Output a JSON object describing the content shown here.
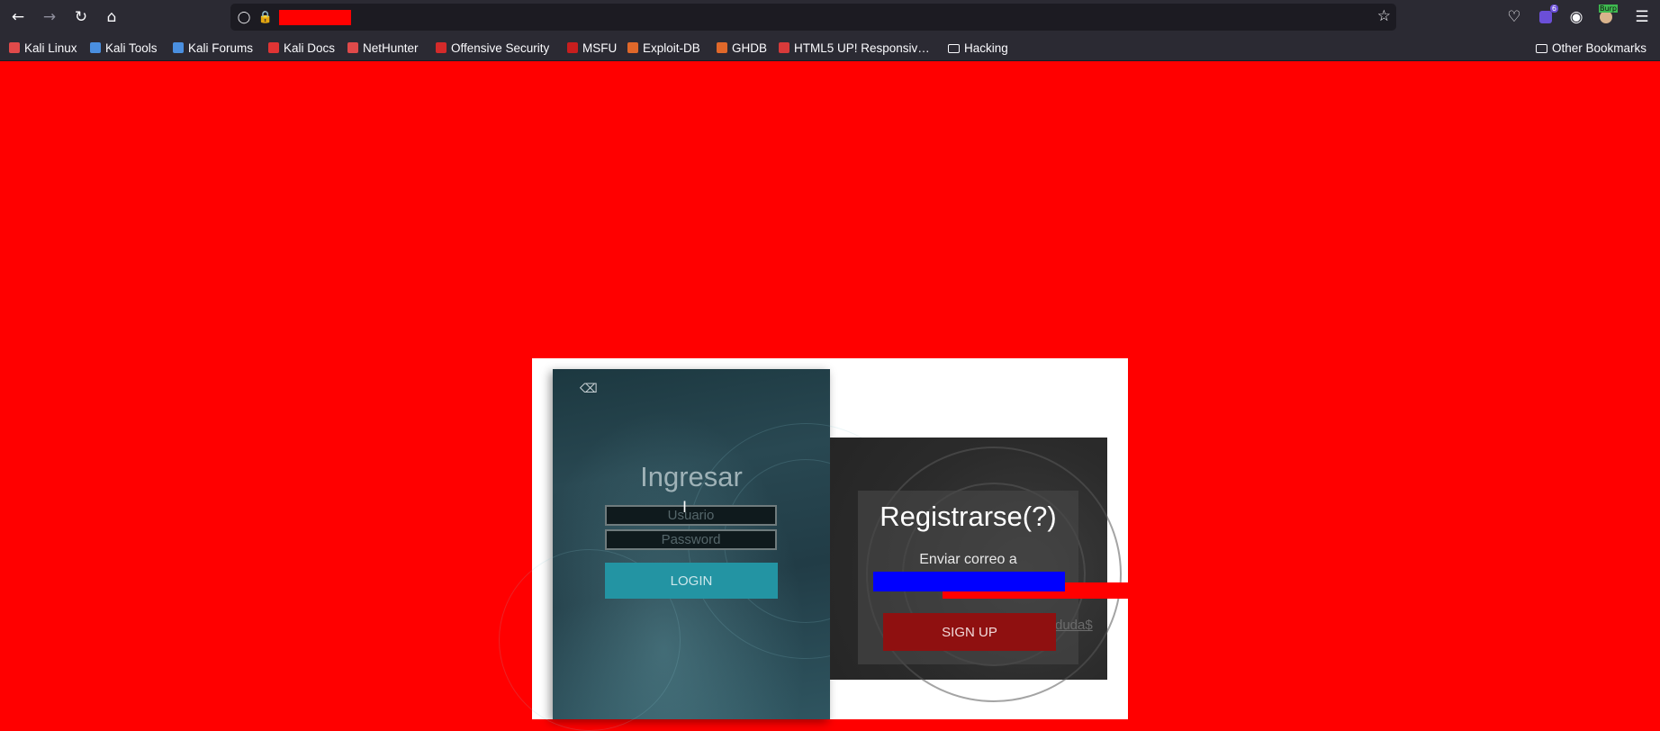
{
  "bookmarks": [
    {
      "label": "Kali Linux",
      "icon": "kali-dragon-icon",
      "color": "#e04a4a"
    },
    {
      "label": "Kali Tools",
      "icon": "kali-tools-icon",
      "color": "#4a8fe0"
    },
    {
      "label": "Kali Forums",
      "icon": "kali-forums-icon",
      "color": "#4a8fe0"
    },
    {
      "label": "Kali Docs",
      "icon": "kali-docs-icon",
      "color": "#e03434"
    },
    {
      "label": "NetHunter",
      "icon": "nethunter-icon",
      "color": "#e04a4a"
    },
    {
      "label": "Offensive Security",
      "icon": "offsec-icon",
      "color": "#d42a2a"
    },
    {
      "label": "MSFU",
      "icon": "msfu-icon",
      "color": "#c81e1e"
    },
    {
      "label": "Exploit-DB",
      "icon": "exploit-db-icon",
      "color": "#e0682a"
    },
    {
      "label": "GHDB",
      "icon": "ghdb-icon",
      "color": "#e0682a"
    },
    {
      "label": "HTML5 UP! Responsiv…",
      "icon": "html5up-icon",
      "color": "#d83a3a"
    },
    {
      "label": "Hacking",
      "icon": "folder-icon"
    }
  ],
  "other_bookmarks": "Other Bookmarks",
  "extensions": {
    "badge_count": "6",
    "burp_label": "Burp"
  },
  "login": {
    "title": "Ingresar",
    "username_placeholder": "Usuario",
    "password_placeholder": "Password",
    "button_label": "LOGIN"
  },
  "register": {
    "title": "Registrarse(?)",
    "subtitle": "Enviar correo a",
    "button_label": "SIGN UP",
    "link_text": "duda$"
  },
  "colors": {
    "page_background": "#ff0000",
    "login_button": "#2394a3",
    "signup_button": "#8f1010",
    "redaction_blue": "#0000ff"
  }
}
